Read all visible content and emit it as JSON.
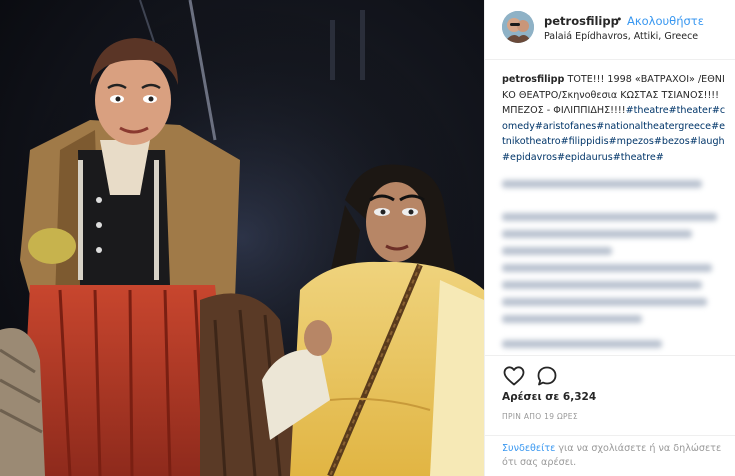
{
  "post": {
    "username": "petrosfilipp",
    "separator": "•",
    "follow_label": "Ακολουθήστε",
    "location": "Palaiá Epídhavros, Attiki, Greece"
  },
  "caption": {
    "username": "petrosfilipp",
    "text": " ΤΟΤΕ!!! 1998 «ΒΑΤΡΑΧΟΙ» /ΕΘΝΙΚΟ ΘΕΑΤΡΟ/Σκηνοθεσια ΚΩΣΤΑΣ ΤΣΙΑΝΟΣ!!!! ΜΠΕΖΟΣ - ΦΙΛΙΠΠΙΔΗΣ!!!!",
    "hashtags": "#theatre#theater#comedy#aristofanes#nationaltheatergreece#etnikotheatro#filippidis#mpezos#bezos#laugh#epidavros#epidaurus#theatre#"
  },
  "actions": {
    "heart_icon": "heart-outline",
    "comment_icon": "speech-bubble-outline",
    "likes": "Αρέσει σε 6,324",
    "timestamp": "ΠΡΙΝ ΑΠΟ 19 ΩΡΕΣ"
  },
  "footer": {
    "login_link": "Συνδεθείτε",
    "login_text": " για να σχολιάσετε ή να δηλώσετε ότι σας αρέσει."
  },
  "colors": {
    "link": "#3897f0",
    "hashtag": "#003569",
    "muted": "#999999",
    "text": "#262626"
  }
}
